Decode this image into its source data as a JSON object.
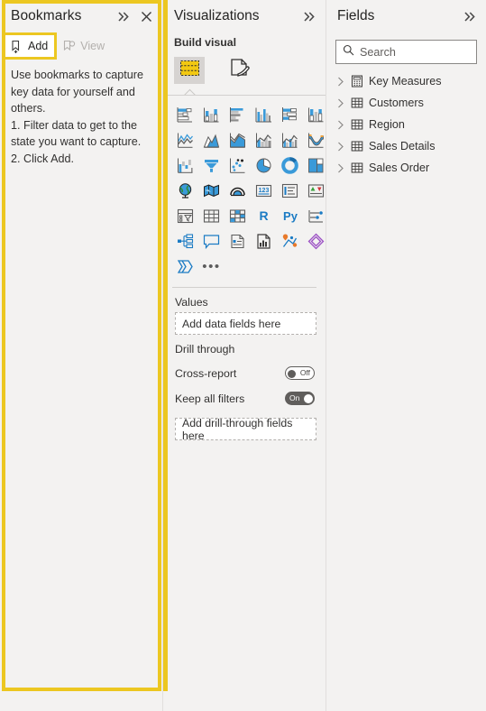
{
  "bookmarks": {
    "title": "Bookmarks",
    "collapse_icon": "double-chevron-right-icon",
    "close_icon": "close-icon",
    "add_label": "Add",
    "view_label": "View",
    "help_line1": "Use bookmarks to capture key data for yourself and others.",
    "help_line2": "1. Filter data to get to the state you want to capture.",
    "help_line3": "2. Click Add.",
    "highlight_color": "#ecc721"
  },
  "visualizations": {
    "title": "Visualizations",
    "collapse_icon": "double-chevron-right-icon",
    "build_visual_label": "Build visual",
    "tabs": [
      {
        "name": "build-visual-tab",
        "icon": "visual-fields-grid-icon",
        "active": true
      },
      {
        "name": "format-visual-tab",
        "icon": "paintbrush-page-icon",
        "active": false
      }
    ],
    "icons": [
      "stacked-bar-chart-icon",
      "stacked-column-chart-icon",
      "clustered-bar-chart-icon",
      "clustered-column-chart-icon",
      "hundred-percent-stacked-bar-chart-icon",
      "hundred-percent-stacked-column-chart-icon",
      "line-chart-icon",
      "area-chart-icon",
      "stacked-area-chart-icon",
      "line-stacked-column-chart-icon",
      "line-clustered-column-chart-icon",
      "ribbon-chart-icon",
      "waterfall-chart-icon",
      "funnel-chart-icon",
      "scatter-chart-icon",
      "pie-chart-icon",
      "donut-chart-icon",
      "treemap-icon",
      "map-icon",
      "filled-map-icon",
      "azure-map-icon",
      "card-icon",
      "multi-row-card-icon",
      "kpi-icon",
      "slicer-icon",
      "table-icon",
      "matrix-icon",
      "r-script-visual-icon",
      "python-visual-icon",
      "key-influencers-icon",
      "decomposition-tree-icon",
      "qna-icon",
      "smart-narrative-icon",
      "metrics-icon",
      "paginated-report-icon",
      "power-apps-icon",
      "arcgis-maps-icon",
      "more-options-icon"
    ],
    "values_label": "Values",
    "values_dropzone": "Add data fields here",
    "drill_through_label": "Drill through",
    "cross_report_label": "Cross-report",
    "cross_report_state": "Off",
    "keep_all_filters_label": "Keep all filters",
    "keep_all_filters_state": "On",
    "drill_dropzone": "Add drill-through fields here",
    "highlight_color": "#ecc721"
  },
  "fields": {
    "title": "Fields",
    "collapse_icon": "double-chevron-right-icon",
    "search_placeholder": "Search",
    "search_value": "",
    "search_icon": "search-icon",
    "tables": [
      {
        "label": "Key Measures",
        "icon": "calculator-icon",
        "expanded": false
      },
      {
        "label": "Customers",
        "icon": "table-icon",
        "expanded": false
      },
      {
        "label": "Region",
        "icon": "table-icon",
        "expanded": false
      },
      {
        "label": "Sales Details",
        "icon": "table-icon",
        "expanded": false
      },
      {
        "label": "Sales Order",
        "icon": "table-icon",
        "expanded": false
      }
    ]
  }
}
